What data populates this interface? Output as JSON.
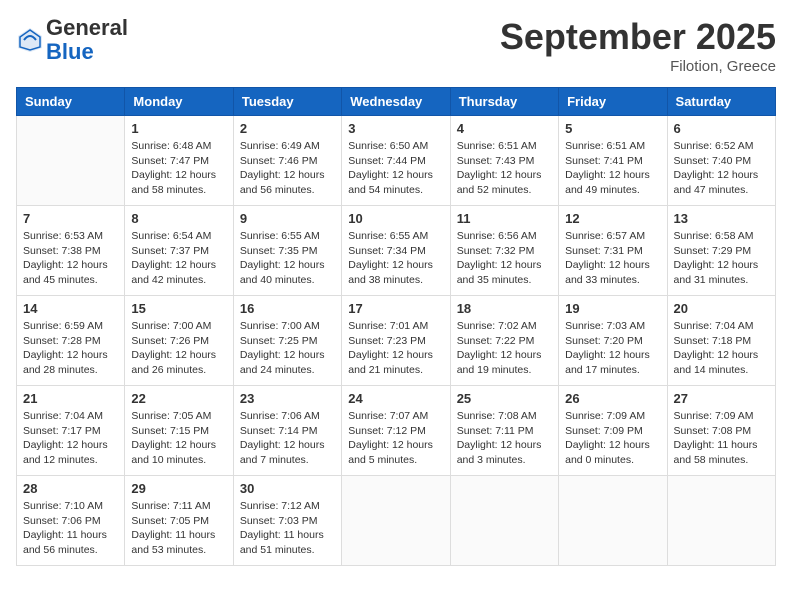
{
  "header": {
    "logo_general": "General",
    "logo_blue": "Blue",
    "month": "September 2025",
    "location": "Filotion, Greece"
  },
  "days_of_week": [
    "Sunday",
    "Monday",
    "Tuesday",
    "Wednesday",
    "Thursday",
    "Friday",
    "Saturday"
  ],
  "weeks": [
    [
      {
        "day": "",
        "info": ""
      },
      {
        "day": "1",
        "info": "Sunrise: 6:48 AM\nSunset: 7:47 PM\nDaylight: 12 hours\nand 58 minutes."
      },
      {
        "day": "2",
        "info": "Sunrise: 6:49 AM\nSunset: 7:46 PM\nDaylight: 12 hours\nand 56 minutes."
      },
      {
        "day": "3",
        "info": "Sunrise: 6:50 AM\nSunset: 7:44 PM\nDaylight: 12 hours\nand 54 minutes."
      },
      {
        "day": "4",
        "info": "Sunrise: 6:51 AM\nSunset: 7:43 PM\nDaylight: 12 hours\nand 52 minutes."
      },
      {
        "day": "5",
        "info": "Sunrise: 6:51 AM\nSunset: 7:41 PM\nDaylight: 12 hours\nand 49 minutes."
      },
      {
        "day": "6",
        "info": "Sunrise: 6:52 AM\nSunset: 7:40 PM\nDaylight: 12 hours\nand 47 minutes."
      }
    ],
    [
      {
        "day": "7",
        "info": "Sunrise: 6:53 AM\nSunset: 7:38 PM\nDaylight: 12 hours\nand 45 minutes."
      },
      {
        "day": "8",
        "info": "Sunrise: 6:54 AM\nSunset: 7:37 PM\nDaylight: 12 hours\nand 42 minutes."
      },
      {
        "day": "9",
        "info": "Sunrise: 6:55 AM\nSunset: 7:35 PM\nDaylight: 12 hours\nand 40 minutes."
      },
      {
        "day": "10",
        "info": "Sunrise: 6:55 AM\nSunset: 7:34 PM\nDaylight: 12 hours\nand 38 minutes."
      },
      {
        "day": "11",
        "info": "Sunrise: 6:56 AM\nSunset: 7:32 PM\nDaylight: 12 hours\nand 35 minutes."
      },
      {
        "day": "12",
        "info": "Sunrise: 6:57 AM\nSunset: 7:31 PM\nDaylight: 12 hours\nand 33 minutes."
      },
      {
        "day": "13",
        "info": "Sunrise: 6:58 AM\nSunset: 7:29 PM\nDaylight: 12 hours\nand 31 minutes."
      }
    ],
    [
      {
        "day": "14",
        "info": "Sunrise: 6:59 AM\nSunset: 7:28 PM\nDaylight: 12 hours\nand 28 minutes."
      },
      {
        "day": "15",
        "info": "Sunrise: 7:00 AM\nSunset: 7:26 PM\nDaylight: 12 hours\nand 26 minutes."
      },
      {
        "day": "16",
        "info": "Sunrise: 7:00 AM\nSunset: 7:25 PM\nDaylight: 12 hours\nand 24 minutes."
      },
      {
        "day": "17",
        "info": "Sunrise: 7:01 AM\nSunset: 7:23 PM\nDaylight: 12 hours\nand 21 minutes."
      },
      {
        "day": "18",
        "info": "Sunrise: 7:02 AM\nSunset: 7:22 PM\nDaylight: 12 hours\nand 19 minutes."
      },
      {
        "day": "19",
        "info": "Sunrise: 7:03 AM\nSunset: 7:20 PM\nDaylight: 12 hours\nand 17 minutes."
      },
      {
        "day": "20",
        "info": "Sunrise: 7:04 AM\nSunset: 7:18 PM\nDaylight: 12 hours\nand 14 minutes."
      }
    ],
    [
      {
        "day": "21",
        "info": "Sunrise: 7:04 AM\nSunset: 7:17 PM\nDaylight: 12 hours\nand 12 minutes."
      },
      {
        "day": "22",
        "info": "Sunrise: 7:05 AM\nSunset: 7:15 PM\nDaylight: 12 hours\nand 10 minutes."
      },
      {
        "day": "23",
        "info": "Sunrise: 7:06 AM\nSunset: 7:14 PM\nDaylight: 12 hours\nand 7 minutes."
      },
      {
        "day": "24",
        "info": "Sunrise: 7:07 AM\nSunset: 7:12 PM\nDaylight: 12 hours\nand 5 minutes."
      },
      {
        "day": "25",
        "info": "Sunrise: 7:08 AM\nSunset: 7:11 PM\nDaylight: 12 hours\nand 3 minutes."
      },
      {
        "day": "26",
        "info": "Sunrise: 7:09 AM\nSunset: 7:09 PM\nDaylight: 12 hours\nand 0 minutes."
      },
      {
        "day": "27",
        "info": "Sunrise: 7:09 AM\nSunset: 7:08 PM\nDaylight: 11 hours\nand 58 minutes."
      }
    ],
    [
      {
        "day": "28",
        "info": "Sunrise: 7:10 AM\nSunset: 7:06 PM\nDaylight: 11 hours\nand 56 minutes."
      },
      {
        "day": "29",
        "info": "Sunrise: 7:11 AM\nSunset: 7:05 PM\nDaylight: 11 hours\nand 53 minutes."
      },
      {
        "day": "30",
        "info": "Sunrise: 7:12 AM\nSunset: 7:03 PM\nDaylight: 11 hours\nand 51 minutes."
      },
      {
        "day": "",
        "info": ""
      },
      {
        "day": "",
        "info": ""
      },
      {
        "day": "",
        "info": ""
      },
      {
        "day": "",
        "info": ""
      }
    ]
  ]
}
